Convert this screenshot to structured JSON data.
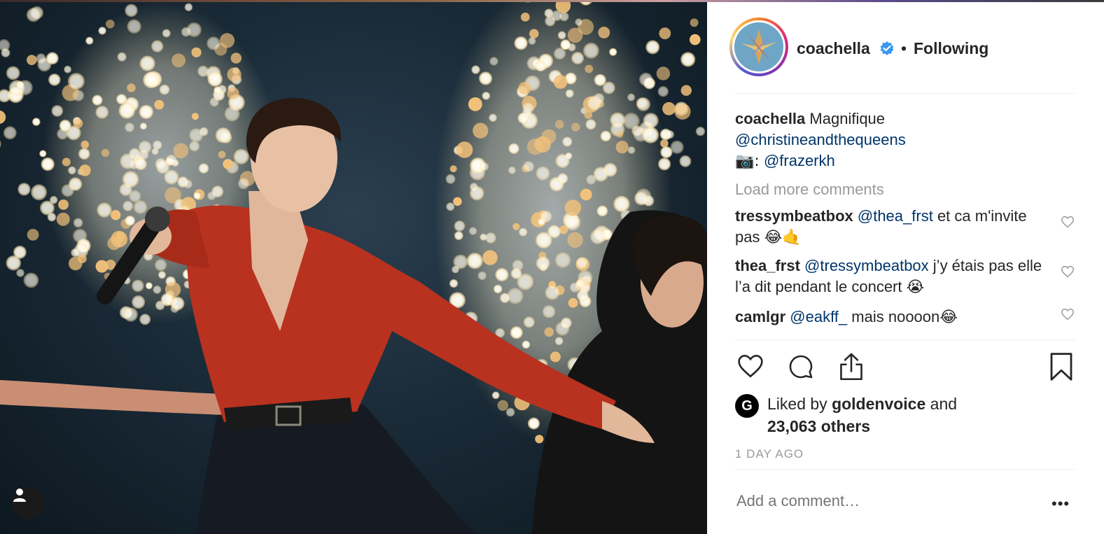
{
  "post": {
    "username": "coachella",
    "follow_status": "Following",
    "separator_dot": "•",
    "caption": {
      "username": "coachella",
      "text": "Magnifique",
      "mention": "@christineandthequeens",
      "credit_prefix": "📷:",
      "credit_mention": "@frazerkh"
    },
    "load_more": "Load more comments",
    "comments": [
      {
        "username": "tressymbeatbox",
        "mention": "@thea_frst",
        "text": "et ca m'invite pas",
        "emoji": "😂🤙"
      },
      {
        "username": "thea_frst",
        "mention": "@tressymbeatbox",
        "text": "j’y étais pas elle l’a dit pendant le concert",
        "emoji": "😭"
      },
      {
        "username": "camlgr",
        "mention": "@eakff_",
        "text": "mais noooon",
        "emoji": "😂"
      }
    ],
    "likes": {
      "prefix": "Liked by",
      "liker": "goldenvoice",
      "conjunction": "and",
      "others": "23,063 others",
      "liker_logo_letter": "G"
    },
    "timestamp": "1 DAY AGO",
    "add_comment_placeholder": "Add a comment…",
    "more_options": "•••"
  },
  "colors": {
    "verified": "#3897f0",
    "mention": "#003569",
    "muted": "#999999",
    "shirt_red": "#c0321f"
  },
  "icons": [
    "verified-icon",
    "heart-icon",
    "comment-icon",
    "share-icon",
    "bookmark-icon",
    "user-tag-icon",
    "more-options-icon"
  ]
}
